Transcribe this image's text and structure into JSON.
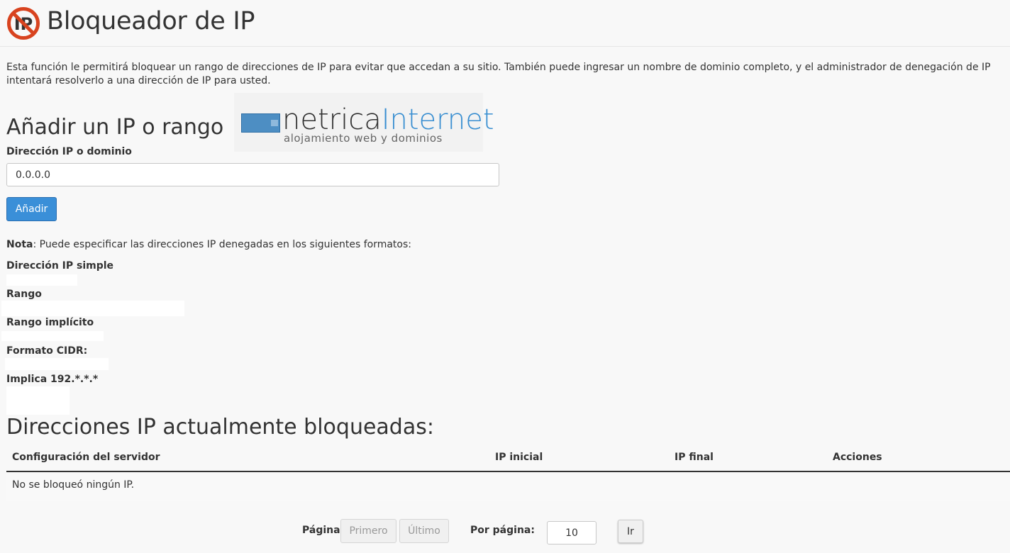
{
  "header": {
    "title": "Bloqueador de IP",
    "icon": "ip-blocker-icon",
    "icon_colors": {
      "ring": "#d8431f",
      "text": "#333333"
    }
  },
  "description": "Esta función le permitirá bloquear un rango de direcciones de IP para evitar que accedan a su sitio. También puede ingresar un nombre de dominio completo, y el administrador de denegación de IP intentará resolverlo a una dirección de IP para usted.",
  "add_section": {
    "title": "Añadir un IP o rango",
    "field_label": "Dirección IP o dominio",
    "field_value": "0.0.0.0",
    "button_label": "Añadir"
  },
  "logo": {
    "name_part1": "netrica",
    "name_part2": "Internet",
    "tagline": "alojamiento web y dominios"
  },
  "note": {
    "prefix": "Nota",
    "text": ": Puede especificar las direcciones IP denegadas en los siguientes formatos:"
  },
  "formats": [
    {
      "label": "Dirección IP simple"
    },
    {
      "label": "Rango"
    },
    {
      "label": "Rango implícito"
    },
    {
      "label": "Formato CIDR:"
    },
    {
      "label": "Implica 192.*.*.*"
    }
  ],
  "blocked_section": {
    "title": "Direcciones IP actualmente bloqueadas:",
    "columns": [
      "Configuración del servidor",
      "IP inicial",
      "IP final",
      "Acciones"
    ],
    "empty_message": "No se bloqueó ningún IP."
  },
  "pagination": {
    "page_label": "Página:",
    "first_label": "Primero",
    "last_label": "Último",
    "per_page_label": "Por página:",
    "per_page_value": "10",
    "go_label": "Ir"
  },
  "colors": {
    "accent": "#3a8fd8",
    "logo_blue": "#3a8fd1",
    "background": "#f8f8f8"
  }
}
